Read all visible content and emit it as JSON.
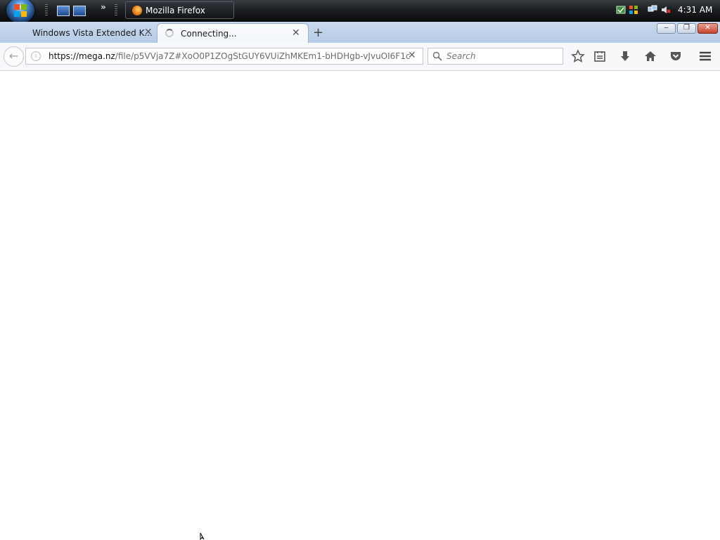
{
  "taskbar": {
    "chevrons": "»",
    "task_button_label": "Mozilla Firefox",
    "clock": "4:31 AM"
  },
  "tabs": [
    {
      "title": "Windows Vista Extended K...",
      "state": "inactive"
    },
    {
      "title": "Connecting...",
      "state": "active-loading"
    }
  ],
  "new_tab_label": "+",
  "window_controls": {
    "minimize": "‒",
    "restore": "❐",
    "close": "✕"
  },
  "navbar": {
    "url_host": "https://mega.nz",
    "url_path": "/file/p5VVja7Z#XoO0P1ZOgStGUY6VUiZhMKEm1-bHDHgb-vJvuOI6F1c",
    "search_placeholder": "Search"
  },
  "icons": [
    "start-orb-icon",
    "quick-launch-icon",
    "firefox-icon",
    "network-icon",
    "volume-muted-icon",
    "back-arrow-icon",
    "info-icon",
    "stop-icon",
    "search-icon",
    "bookmark-star-icon",
    "reading-list-icon",
    "download-icon",
    "home-icon",
    "pocket-icon",
    "menu-icon",
    "mouse-cursor-icon"
  ],
  "colors": {
    "accent": "#4c8fd6",
    "tabstrip": "#c9d9ee",
    "close_button": "#c6422c"
  }
}
